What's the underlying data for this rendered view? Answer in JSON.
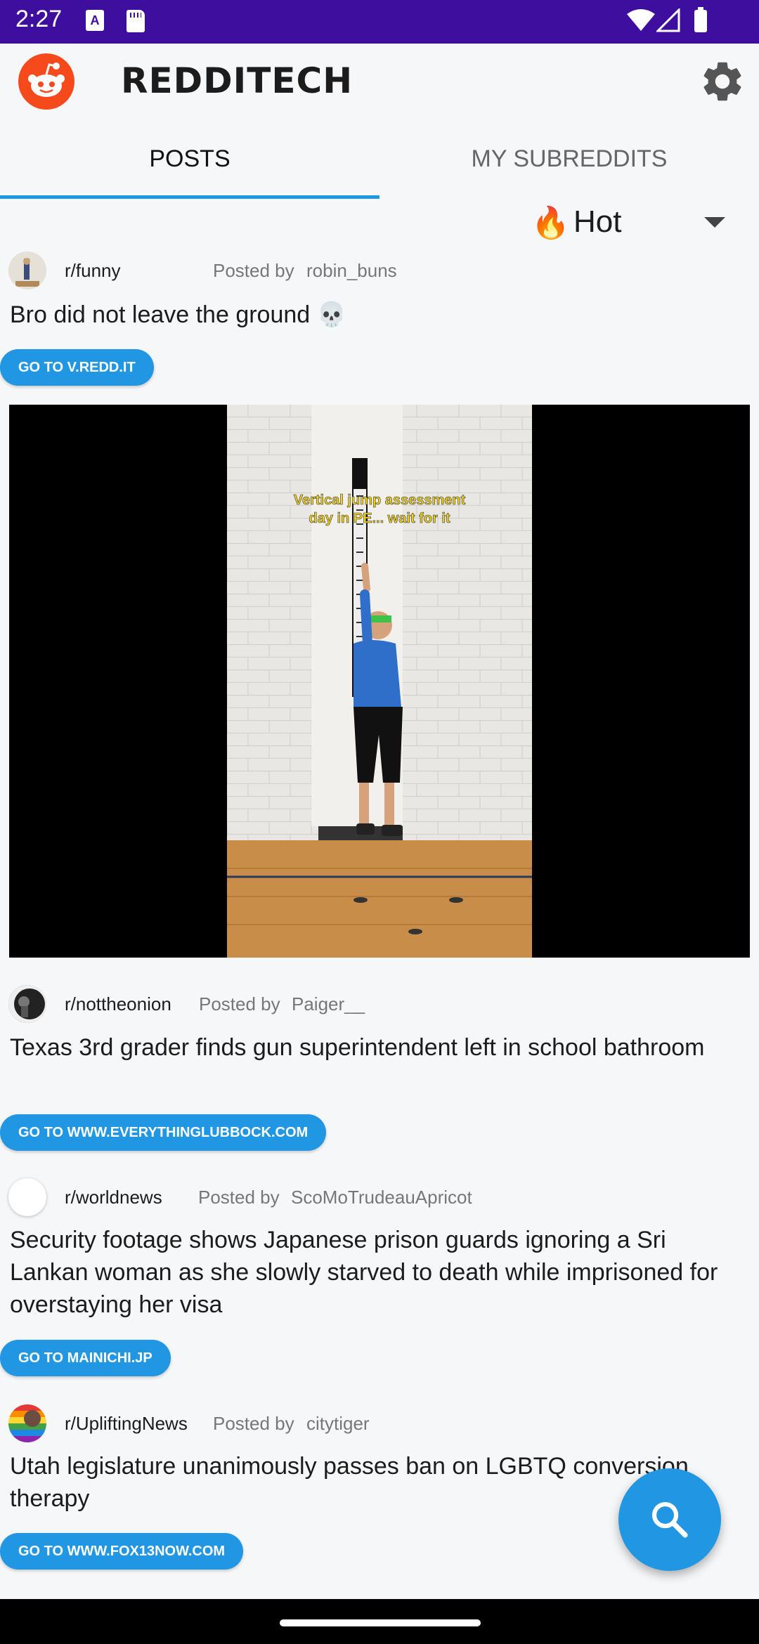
{
  "status_bar": {
    "time": "2:27",
    "icons": [
      "text-notification-icon",
      "sd-card-icon",
      "wifi-icon",
      "signal-icon",
      "battery-icon"
    ],
    "text_icon_glyph": "A"
  },
  "app": {
    "title": "REDDITECH",
    "logo": "reddit-logo",
    "settings_icon": "gear-icon"
  },
  "tabs": [
    {
      "label": "POSTS",
      "selected": true
    },
    {
      "label": "MY SUBREDDITS",
      "selected": false
    }
  ],
  "sort": {
    "emoji": "🔥",
    "label": "Hot"
  },
  "colors": {
    "accent": "#2196e3",
    "status_bar": "#3e0f9e",
    "reddit_orange": "#f64a1d"
  },
  "posts": [
    {
      "subreddit": "r/funny",
      "posted_by_label": "Posted by",
      "author": "robin_buns",
      "title": "Bro did not leave the ground 💀",
      "link_label": "GO TO V.REDD.IT",
      "media_caption": "Vertical jump assessment\nday in PE... wait for it"
    },
    {
      "subreddit": "r/nottheonion",
      "posted_by_label": "Posted by",
      "author": "Paiger__",
      "title": "Texas 3rd grader finds gun superintendent left in school bathroom",
      "link_label": "GO TO WWW.EVERYTHINGLUBBOCK.COM"
    },
    {
      "subreddit": "r/worldnews",
      "posted_by_label": "Posted by",
      "author": "ScoMoTrudeauApricot",
      "title": "Security footage shows Japanese prison guards ignoring a Sri Lankan woman as she slowly starved to death while imprisoned for overstaying her visa",
      "link_label": "GO TO MAINICHI.JP"
    },
    {
      "subreddit": "r/UpliftingNews",
      "posted_by_label": "Posted by",
      "author": "citytiger",
      "title": "Utah legislature unanimously passes ban on LGBTQ conversion therapy",
      "link_label": "GO TO WWW.FOX13NOW.COM"
    }
  ],
  "fab": {
    "icon": "search-icon"
  }
}
